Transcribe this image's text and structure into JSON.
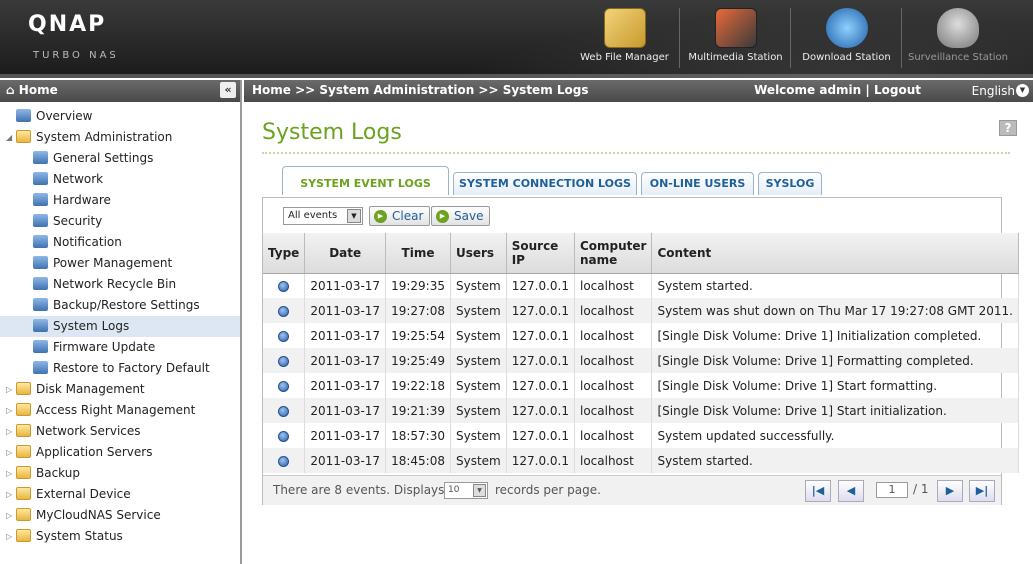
{
  "brand": {
    "logo": "QNAP",
    "subtitle": "TURBO NAS"
  },
  "apps": [
    {
      "label": "Web File Manager",
      "icon": "web-file-manager-icon"
    },
    {
      "label": "Multimedia Station",
      "icon": "multimedia-station-icon"
    },
    {
      "label": "Download Station",
      "icon": "download-station-icon"
    },
    {
      "label": "Surveillance Station",
      "icon": "surveillance-station-icon"
    }
  ],
  "left": {
    "header": "Home",
    "collapse_glyph": "«",
    "tree": [
      {
        "label": "Overview",
        "level": 0,
        "type": "page"
      },
      {
        "label": "System Administration",
        "level": 0,
        "type": "folder",
        "expanded": true
      },
      {
        "label": "General Settings",
        "level": 1
      },
      {
        "label": "Network",
        "level": 1
      },
      {
        "label": "Hardware",
        "level": 1
      },
      {
        "label": "Security",
        "level": 1
      },
      {
        "label": "Notification",
        "level": 1
      },
      {
        "label": "Power Management",
        "level": 1
      },
      {
        "label": "Network Recycle Bin",
        "level": 1
      },
      {
        "label": "Backup/Restore Settings",
        "level": 1
      },
      {
        "label": "System Logs",
        "level": 1,
        "selected": true
      },
      {
        "label": "Firmware Update",
        "level": 1
      },
      {
        "label": "Restore to Factory Default",
        "level": 1
      },
      {
        "label": "Disk Management",
        "level": 0,
        "type": "folder"
      },
      {
        "label": "Access Right Management",
        "level": 0,
        "type": "folder"
      },
      {
        "label": "Network Services",
        "level": 0,
        "type": "folder"
      },
      {
        "label": "Application Servers",
        "level": 0,
        "type": "folder"
      },
      {
        "label": "Backup",
        "level": 0,
        "type": "folder"
      },
      {
        "label": "External Device",
        "level": 0,
        "type": "folder"
      },
      {
        "label": "MyCloudNAS Service",
        "level": 0,
        "type": "folder"
      },
      {
        "label": "System Status",
        "level": 0,
        "type": "folder"
      }
    ]
  },
  "crumb": {
    "path": "Home >> System Administration >> System Logs",
    "welcome": "Welcome admin",
    "sep": "|",
    "logout": "Logout",
    "language": "English"
  },
  "page": {
    "title": "System Logs",
    "help": "?"
  },
  "tabs": [
    "SYSTEM EVENT LOGS",
    "SYSTEM CONNECTION LOGS",
    "ON-LINE USERS",
    "SYSLOG"
  ],
  "toolbar": {
    "filter": "All events",
    "clear": "Clear",
    "save": "Save"
  },
  "table": {
    "headers": [
      "Type",
      "Date",
      "Time",
      "Users",
      "Source IP",
      "Computer name",
      "Content"
    ],
    "rows": [
      {
        "date": "2011-03-17",
        "time": "19:29:35",
        "user": "System",
        "ip": "127.0.0.1",
        "host": "localhost",
        "content": "System started."
      },
      {
        "date": "2011-03-17",
        "time": "19:27:08",
        "user": "System",
        "ip": "127.0.0.1",
        "host": "localhost",
        "content": "System was shut down on Thu Mar 17 19:27:08 GMT 2011."
      },
      {
        "date": "2011-03-17",
        "time": "19:25:54",
        "user": "System",
        "ip": "127.0.0.1",
        "host": "localhost",
        "content": "[Single Disk Volume: Drive 1] Initialization completed."
      },
      {
        "date": "2011-03-17",
        "time": "19:25:49",
        "user": "System",
        "ip": "127.0.0.1",
        "host": "localhost",
        "content": "[Single Disk Volume: Drive 1] Formatting completed."
      },
      {
        "date": "2011-03-17",
        "time": "19:22:18",
        "user": "System",
        "ip": "127.0.0.1",
        "host": "localhost",
        "content": "[Single Disk Volume: Drive 1] Start formatting."
      },
      {
        "date": "2011-03-17",
        "time": "19:21:39",
        "user": "System",
        "ip": "127.0.0.1",
        "host": "localhost",
        "content": "[Single Disk Volume: Drive 1] Start initialization."
      },
      {
        "date": "2011-03-17",
        "time": "18:57:30",
        "user": "System",
        "ip": "127.0.0.1",
        "host": "localhost",
        "content": "System updated successfully."
      },
      {
        "date": "2011-03-17",
        "time": "18:45:08",
        "user": "System",
        "ip": "127.0.0.1",
        "host": "localhost",
        "content": "System started."
      }
    ]
  },
  "footer": {
    "count_text": "There are 8 events. Displays",
    "per_page": "10",
    "per_page_suffix": "records per page.",
    "page": "1",
    "total": "/ 1"
  },
  "colors": {
    "accent_green": "#6ba21e",
    "link_blue": "#1f5f9a",
    "header_dark": "#4a4a4a"
  }
}
